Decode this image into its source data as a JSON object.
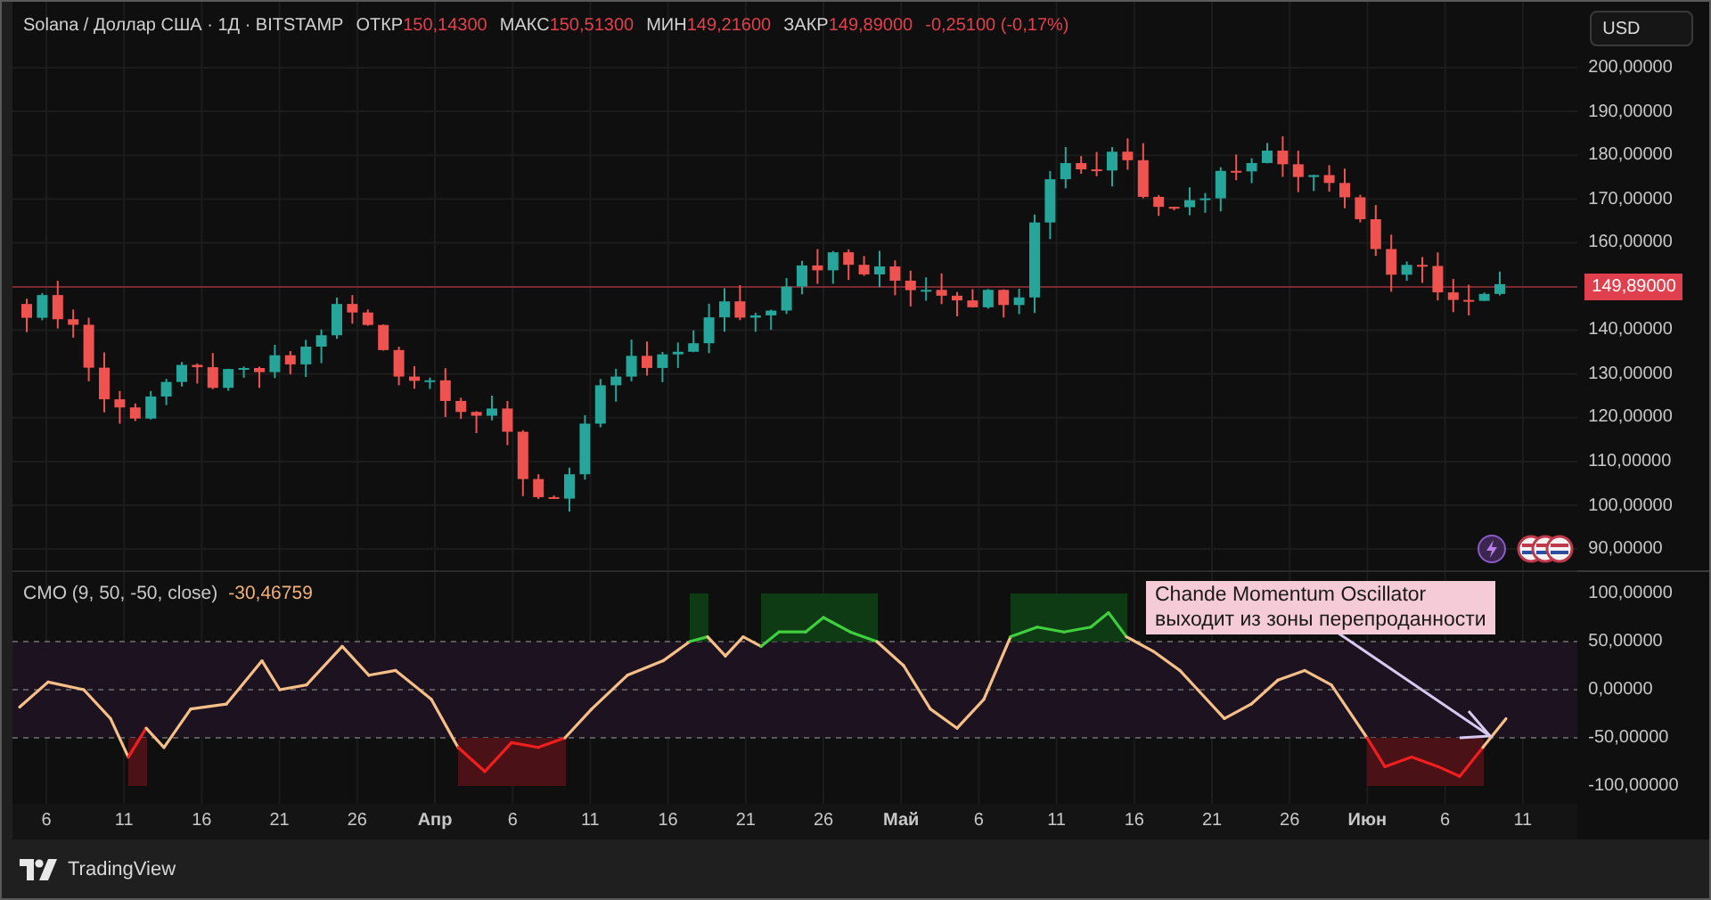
{
  "header": {
    "symbol": "Solana / Доллар США · 1Д · BITSTAMP",
    "ohlc": [
      {
        "label": "ОТКР",
        "value": "150,14300"
      },
      {
        "label": "МАКС",
        "value": "150,51300"
      },
      {
        "label": "МИН",
        "value": "149,21600"
      },
      {
        "label": "ЗАКР",
        "value": "149,89000"
      }
    ],
    "change": "-0,25100 (-0,17%)"
  },
  "price_axis": {
    "currency": "USD",
    "ticks": [
      "200,00000",
      "190,00000",
      "180,00000",
      "170,00000",
      "160,00000",
      "140,00000",
      "130,00000",
      "120,00000",
      "110,00000",
      "100,00000",
      "90,00000"
    ],
    "last_price": "149,89000"
  },
  "indicator": {
    "label": "CMO (9, 50, -50, close)",
    "value": "-30,46759",
    "ticks": [
      "100,00000",
      "50,00000",
      "0,00000",
      "-50,00000",
      "-100,00000"
    ]
  },
  "annotation": {
    "lines": [
      "Chande Momentum Oscillator",
      "выходит из зоны перепроданности"
    ]
  },
  "time_axis": {
    "labels": [
      {
        "text": "6",
        "kind": "day"
      },
      {
        "text": "11",
        "kind": "day"
      },
      {
        "text": "16",
        "kind": "day"
      },
      {
        "text": "21",
        "kind": "day"
      },
      {
        "text": "26",
        "kind": "day"
      },
      {
        "text": "Апр",
        "kind": "month"
      },
      {
        "text": "6",
        "kind": "day"
      },
      {
        "text": "11",
        "kind": "day"
      },
      {
        "text": "16",
        "kind": "day"
      },
      {
        "text": "21",
        "kind": "day"
      },
      {
        "text": "26",
        "kind": "day"
      },
      {
        "text": "Май",
        "kind": "month"
      },
      {
        "text": "6",
        "kind": "day"
      },
      {
        "text": "11",
        "kind": "day"
      },
      {
        "text": "16",
        "kind": "day"
      },
      {
        "text": "21",
        "kind": "day"
      },
      {
        "text": "26",
        "kind": "day"
      },
      {
        "text": "Июн",
        "kind": "month"
      },
      {
        "text": "6",
        "kind": "day"
      },
      {
        "text": "11",
        "kind": "day"
      }
    ]
  },
  "footer": {
    "brand": "TradingView"
  }
}
